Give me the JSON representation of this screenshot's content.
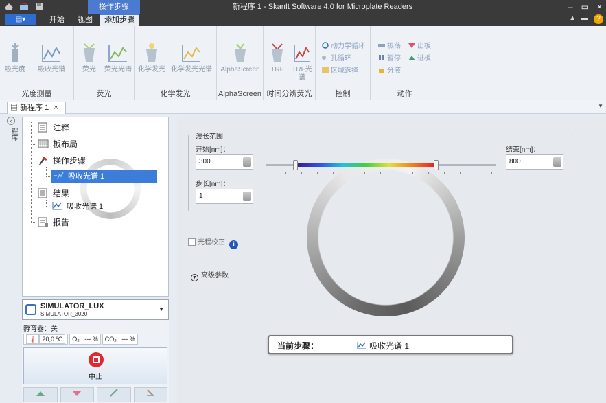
{
  "window": {
    "title": "新程序 1 - SkanIt Software 4.0 for Microplate Readers",
    "context_tab": "操作步骤",
    "controls": [
      "–",
      "▭",
      "×"
    ]
  },
  "ribbon_tabs": {
    "file_label": "▤▾",
    "tabs": [
      "开始",
      "视图",
      "添加步骤"
    ],
    "active": "添加步骤"
  },
  "ribbon": {
    "groups": [
      {
        "name": "光度测量",
        "buttons": [
          "吸光度",
          "吸收光谱"
        ]
      },
      {
        "name": "荧光",
        "buttons": [
          "荧光",
          "荧光光谱"
        ]
      },
      {
        "name": "化学发光",
        "buttons": [
          "化学发光",
          "化学发光光谱"
        ]
      },
      {
        "name": "AlphaScreen",
        "buttons": [
          "AlphaScreen"
        ]
      },
      {
        "name": "时间分辨荧光",
        "buttons": [
          "TRF",
          "TRF光谱"
        ]
      },
      {
        "name": "控制",
        "buttons": [
          "动力学循环",
          "孔循环",
          "区域选择"
        ]
      },
      {
        "name": "动作",
        "buttons": [
          "振荡",
          "出板",
          "暂停",
          "进板",
          "分液"
        ]
      }
    ]
  },
  "doc_tab": {
    "label": "新程序 1",
    "close": "×"
  },
  "side_strip": {
    "label": "程序"
  },
  "tree": {
    "nodes": [
      {
        "label": "注释",
        "icon": "note-icon"
      },
      {
        "label": "板布局",
        "icon": "plate-layout-icon"
      },
      {
        "label": "操作步骤",
        "icon": "steps-icon"
      },
      {
        "label": "吸收光谱 1",
        "icon": "spectrum-icon",
        "selected": true
      },
      {
        "label": "结果",
        "icon": "results-icon"
      },
      {
        "label": "吸收光谱 1",
        "icon": "spectrum-icon"
      },
      {
        "label": "报告",
        "icon": "report-icon"
      }
    ]
  },
  "device": {
    "name": "SIMULATOR_LUX",
    "model": "SIMULATOR_3020",
    "incubator": "孵育器：关",
    "temp": "20,0 ºC",
    "o2": "O₂ : --- %",
    "co2": "CO₂ : --- %",
    "stop_label": "中止"
  },
  "wavelength": {
    "group_title": "波长范围",
    "start_label": "开始[nm]：",
    "start_value": "300",
    "end_label": "结束[nm]：",
    "end_value": "800",
    "step_label": "步长[nm]：",
    "step_value": "1"
  },
  "options": {
    "pathlength_label": "光程校正",
    "advanced_label": "高级参数"
  },
  "current_step": {
    "label": "当前步骤：",
    "value": "吸收光谱 1"
  }
}
